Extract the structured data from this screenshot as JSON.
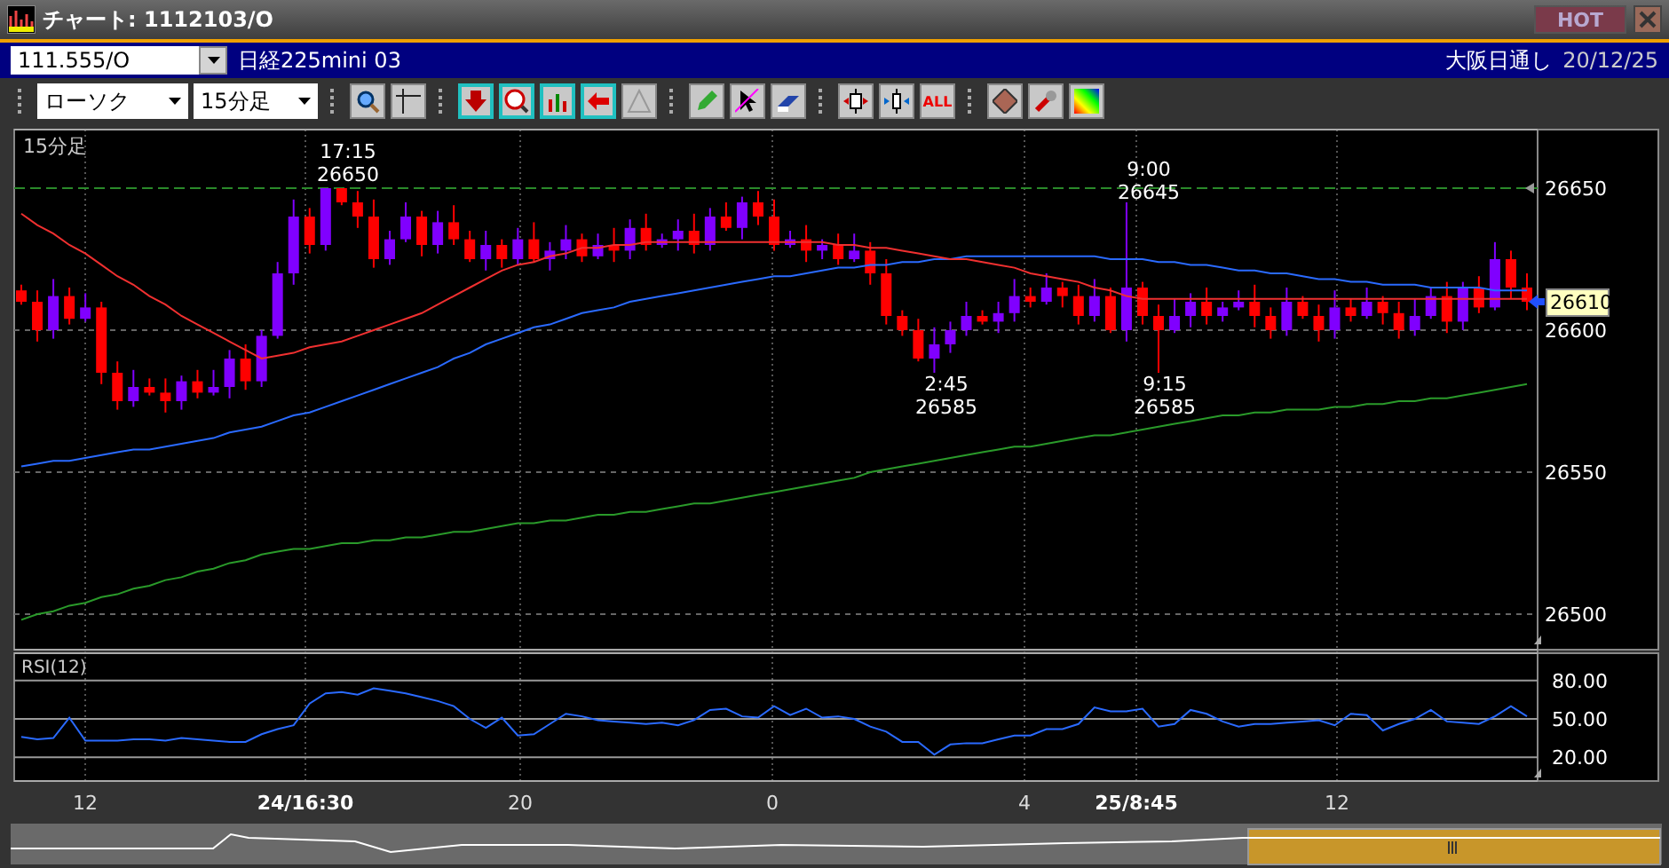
{
  "window": {
    "title": "チャート: 1112103/O",
    "hot_button": "HOT"
  },
  "symbol_bar": {
    "code": "111.555/O",
    "name": "日経225mini 03",
    "session": "大阪日通し",
    "date": "20/12/25"
  },
  "toolbar": {
    "chart_type": "ローソク",
    "interval": "15分足",
    "all_button": "ALL"
  },
  "price_pane": {
    "label": "15分足",
    "annotations": [
      {
        "kind": "high",
        "time": "17:15",
        "price": "26650"
      },
      {
        "kind": "low",
        "time": "2:45",
        "price": "26585"
      },
      {
        "kind": "high",
        "time": "9:00",
        "price": "26645"
      },
      {
        "kind": "low",
        "time": "9:15",
        "price": "26585"
      }
    ],
    "last_price": "26610",
    "candles": {
      "chart_data": {
        "type": "candlestick",
        "ylim": [
          26487.5,
          26670.625
        ],
        "yticks": [
          26500,
          26550,
          26600,
          26650
        ],
        "ohlc": [
          [
            26614,
            26616,
            26609,
            26610
          ],
          [
            26610,
            26614,
            26596,
            26600
          ],
          [
            26600,
            26618,
            26597,
            26612
          ],
          [
            26612,
            26615,
            26602,
            26604
          ],
          [
            26604,
            26613,
            26603,
            26608
          ],
          [
            26608,
            26610,
            26581,
            26585
          ],
          [
            26585,
            26589,
            26572,
            26575
          ],
          [
            26575,
            26586,
            26573,
            26580
          ],
          [
            26580,
            26583,
            26577,
            26578
          ],
          [
            26578,
            26583,
            26571,
            26575
          ],
          [
            26575,
            26584,
            26572,
            26582
          ],
          [
            26582,
            26586,
            26576,
            26578
          ],
          [
            26578,
            26586,
            26577,
            26580
          ],
          [
            26580,
            26593,
            26576,
            26590
          ],
          [
            26590,
            26595,
            26579,
            26582
          ],
          [
            26582,
            26600,
            26580,
            26598
          ],
          [
            26598,
            26624,
            26597,
            26620
          ],
          [
            26620,
            26646,
            26616,
            26640
          ],
          [
            26640,
            26643,
            26627,
            26630
          ],
          [
            26630,
            26650,
            26628,
            26650
          ],
          [
            26650,
            26650,
            26644,
            26645
          ],
          [
            26645,
            26649,
            26636,
            26640
          ],
          [
            26640,
            26646,
            26622,
            26625
          ],
          [
            26625,
            26635,
            26623,
            26632
          ],
          [
            26632,
            26645,
            26631,
            26640
          ],
          [
            26640,
            26642,
            26626,
            26630
          ],
          [
            26630,
            26642,
            26627,
            26638
          ],
          [
            26638,
            26644,
            26630,
            26632
          ],
          [
            26632,
            26635,
            26624,
            26625
          ],
          [
            26625,
            26635,
            26621,
            26630
          ],
          [
            26630,
            26632,
            26622,
            26625
          ],
          [
            26625,
            26636,
            26623,
            26632
          ],
          [
            26632,
            26638,
            26624,
            26625
          ],
          [
            26625,
            26631,
            26621,
            26628
          ],
          [
            26628,
            26637,
            26625,
            26632
          ],
          [
            26632,
            26634,
            26624,
            26626
          ],
          [
            26626,
            26634,
            26625,
            26630
          ],
          [
            26630,
            26636,
            26624,
            26628
          ],
          [
            26628,
            26639,
            26625,
            26636
          ],
          [
            26636,
            26641,
            26628,
            26630
          ],
          [
            26630,
            26634,
            26629,
            26632
          ],
          [
            26632,
            26639,
            26628,
            26635
          ],
          [
            26635,
            26641,
            26627,
            26630
          ],
          [
            26630,
            26643,
            26628,
            26640
          ],
          [
            26640,
            26645,
            26635,
            26636
          ],
          [
            26636,
            26647,
            26632,
            26645
          ],
          [
            26645,
            26649,
            26637,
            26640
          ],
          [
            26640,
            26646,
            26628,
            26630
          ],
          [
            26630,
            26635,
            26629,
            26632
          ],
          [
            26632,
            26637,
            26624,
            26628
          ],
          [
            26628,
            26632,
            26625,
            26630
          ],
          [
            26630,
            26634,
            26623,
            26625
          ],
          [
            26625,
            26634,
            26624,
            26628
          ],
          [
            26628,
            26631,
            26616,
            26620
          ],
          [
            26620,
            26625,
            26602,
            26605
          ],
          [
            26605,
            26607,
            26598,
            26600
          ],
          [
            26600,
            26604,
            26589,
            26590
          ],
          [
            26590,
            26601,
            26585,
            26595
          ],
          [
            26595,
            26603,
            26592,
            26600
          ],
          [
            26600,
            26610,
            26598,
            26605
          ],
          [
            26605,
            26607,
            26602,
            26603
          ],
          [
            26603,
            26610,
            26599,
            26606
          ],
          [
            26606,
            26618,
            26603,
            26612
          ],
          [
            26612,
            26615,
            26608,
            26610
          ],
          [
            26610,
            26620,
            26609,
            26615
          ],
          [
            26615,
            26617,
            26608,
            26612
          ],
          [
            26612,
            26616,
            26602,
            26605
          ],
          [
            26605,
            26618,
            26603,
            26612
          ],
          [
            26612,
            26615,
            26599,
            26600
          ],
          [
            26600,
            26645,
            26596,
            26615
          ],
          [
            26615,
            26617,
            26602,
            26605
          ],
          [
            26605,
            26609,
            26585,
            26600
          ],
          [
            26600,
            26611,
            26599,
            26605
          ],
          [
            26605,
            26613,
            26601,
            26610
          ],
          [
            26610,
            26615,
            26602,
            26605
          ],
          [
            26605,
            26610,
            26603,
            26608
          ],
          [
            26608,
            26614,
            26607,
            26610
          ],
          [
            26610,
            26616,
            26601,
            26605
          ],
          [
            26605,
            26608,
            26597,
            26600
          ],
          [
            26600,
            26615,
            26598,
            26610
          ],
          [
            26610,
            26612,
            26604,
            26605
          ],
          [
            26605,
            26609,
            26596,
            26600
          ],
          [
            26600,
            26614,
            26597,
            26608
          ],
          [
            26608,
            26611,
            26603,
            26605
          ],
          [
            26605,
            26615,
            26604,
            26610
          ],
          [
            26610,
            26612,
            26602,
            26606
          ],
          [
            26606,
            26610,
            26597,
            26600
          ],
          [
            26600,
            26611,
            26598,
            26605
          ],
          [
            26605,
            26615,
            26604,
            26612
          ],
          [
            26612,
            26617,
            26599,
            26603
          ],
          [
            26603,
            26617,
            26600,
            26615
          ],
          [
            26615,
            26619,
            26606,
            26608
          ],
          [
            26608,
            26631,
            26607,
            26625
          ],
          [
            26625,
            26628,
            26611,
            26615
          ],
          [
            26615,
            26620,
            26607,
            26610
          ]
        ]
      }
    },
    "moving_averages": {
      "chart_data": {
        "type": "line",
        "ylim": [
          26487.5,
          26670.625
        ],
        "series": [
          {
            "color": "#f03030",
            "values": [
              26641,
              26637,
              26634,
              26630,
              26627,
              26623,
              26619,
              26616,
              26612,
              26609,
              26605,
              26602,
              26599,
              26596,
              26593,
              26590,
              26591,
              26592,
              26594,
              26595,
              26596,
              26598,
              26600,
              26602,
              26604,
              26606,
              26609,
              26612,
              26615,
              26618,
              26621,
              26623,
              26624,
              26626,
              26627,
              26629,
              26629,
              26630,
              26630,
              26631,
              26631,
              26631,
              26631,
              26631,
              26631,
              26631,
              26631,
              26631,
              26631,
              26631,
              26631,
              26630,
              26630,
              26629,
              26629,
              26628,
              26627,
              26626,
              26625,
              26625,
              26624,
              26623,
              26622,
              26620,
              26619,
              26618,
              26617,
              26615,
              26614,
              26612,
              26611,
              26611,
              26611,
              26611,
              26611,
              26611,
              26611,
              26611,
              26611,
              26611,
              26611,
              26611,
              26611,
              26611,
              26611,
              26611,
              26611,
              26611,
              26611,
              26611,
              26611,
              26611,
              26611,
              26611,
              26611
            ]
          },
          {
            "color": "#2a6aff",
            "values": [
              26552,
              26553,
              26554,
              26554,
              26555,
              26556,
              26557,
              26558,
              26558,
              26559,
              26560,
              26561,
              26562,
              26564,
              26565,
              26566,
              26568,
              26570,
              26571,
              26573,
              26575,
              26577,
              26579,
              26581,
              26583,
              26585,
              26587,
              26590,
              26592,
              26595,
              26597,
              26599,
              26601,
              26602,
              26604,
              26606,
              26607,
              26608,
              26610,
              26611,
              26612,
              26613,
              26614,
              26615,
              26616,
              26617,
              26618,
              26619,
              26619,
              26620,
              26621,
              26622,
              26622,
              26623,
              26623,
              26624,
              26624,
              26625,
              26625,
              26626,
              26626,
              26626,
              26626,
              26626,
              26626,
              26626,
              26626,
              26626,
              26625,
              26625,
              26625,
              26624,
              26624,
              26623,
              26623,
              26622,
              26621,
              26621,
              26620,
              26620,
              26619,
              26618,
              26618,
              26617,
              26617,
              26616,
              26616,
              26616,
              26615,
              26615,
              26615,
              26615,
              26614,
              26614,
              26614
            ]
          },
          {
            "color": "#2a9a2a",
            "values": [
              26498,
              26500,
              26501,
              26503,
              26504,
              26506,
              26507,
              26509,
              26510,
              26512,
              26513,
              26515,
              26516,
              26518,
              26519,
              26521,
              26522,
              26523,
              26523,
              26524,
              26525,
              26525,
              26526,
              26526,
              26527,
              26527,
              26528,
              26529,
              26529,
              26530,
              26531,
              26532,
              26532,
              26533,
              26533,
              26534,
              26535,
              26535,
              26536,
              26536,
              26537,
              26538,
              26539,
              26539,
              26540,
              26541,
              26542,
              26543,
              26544,
              26545,
              26546,
              26547,
              26548,
              26550,
              26551,
              26552,
              26553,
              26554,
              26555,
              26556,
              26557,
              26558,
              26559,
              26559,
              26560,
              26561,
              26562,
              26563,
              26563,
              26564,
              26565,
              26566,
              26567,
              26568,
              26569,
              26570,
              26570,
              26571,
              26571,
              26572,
              26572,
              26572,
              26573,
              26573,
              26574,
              26574,
              26575,
              26575,
              26576,
              26576,
              26577,
              26578,
              26579,
              26580,
              26581
            ]
          }
        ]
      }
    }
  },
  "rsi_pane": {
    "label": "RSI(12)",
    "chart_data": {
      "type": "line",
      "ylim": [
        1.4,
        101.4
      ],
      "yticks": [
        {
          "value": 20,
          "label": "20.00"
        },
        {
          "value": 50,
          "label": "50.00"
        },
        {
          "value": 80,
          "label": "80.00"
        }
      ],
      "series": [
        {
          "color": "#2a6aff",
          "values": [
            36,
            34,
            35,
            51,
            33,
            33,
            33,
            34,
            34,
            33,
            35,
            34,
            33,
            32,
            32,
            38,
            42,
            45,
            62,
            70,
            71,
            69,
            74,
            72,
            70,
            67,
            64,
            60,
            50,
            43,
            51,
            37,
            38,
            46,
            54,
            52,
            49,
            48,
            47,
            46,
            47,
            45,
            49,
            57,
            58,
            52,
            51,
            60,
            53,
            58,
            51,
            52,
            50,
            44,
            40,
            32,
            32,
            22,
            30,
            31,
            31,
            34,
            37,
            37,
            42,
            42,
            46,
            59,
            56,
            56,
            58,
            44,
            46,
            57,
            54,
            48,
            44,
            46,
            46,
            47,
            48,
            49,
            45,
            54,
            53,
            41,
            46,
            50,
            57,
            48,
            47,
            46,
            52,
            60,
            52
          ]
        }
      ]
    }
  },
  "x_axis": [
    {
      "label": "12",
      "major": false
    },
    {
      "label": "24/16:30",
      "major": true
    },
    {
      "label": "20",
      "major": false
    },
    {
      "label": "0",
      "major": false
    },
    {
      "label": "4",
      "major": false
    },
    {
      "label": "25/8:45",
      "major": true
    },
    {
      "label": "12",
      "major": false
    }
  ]
}
